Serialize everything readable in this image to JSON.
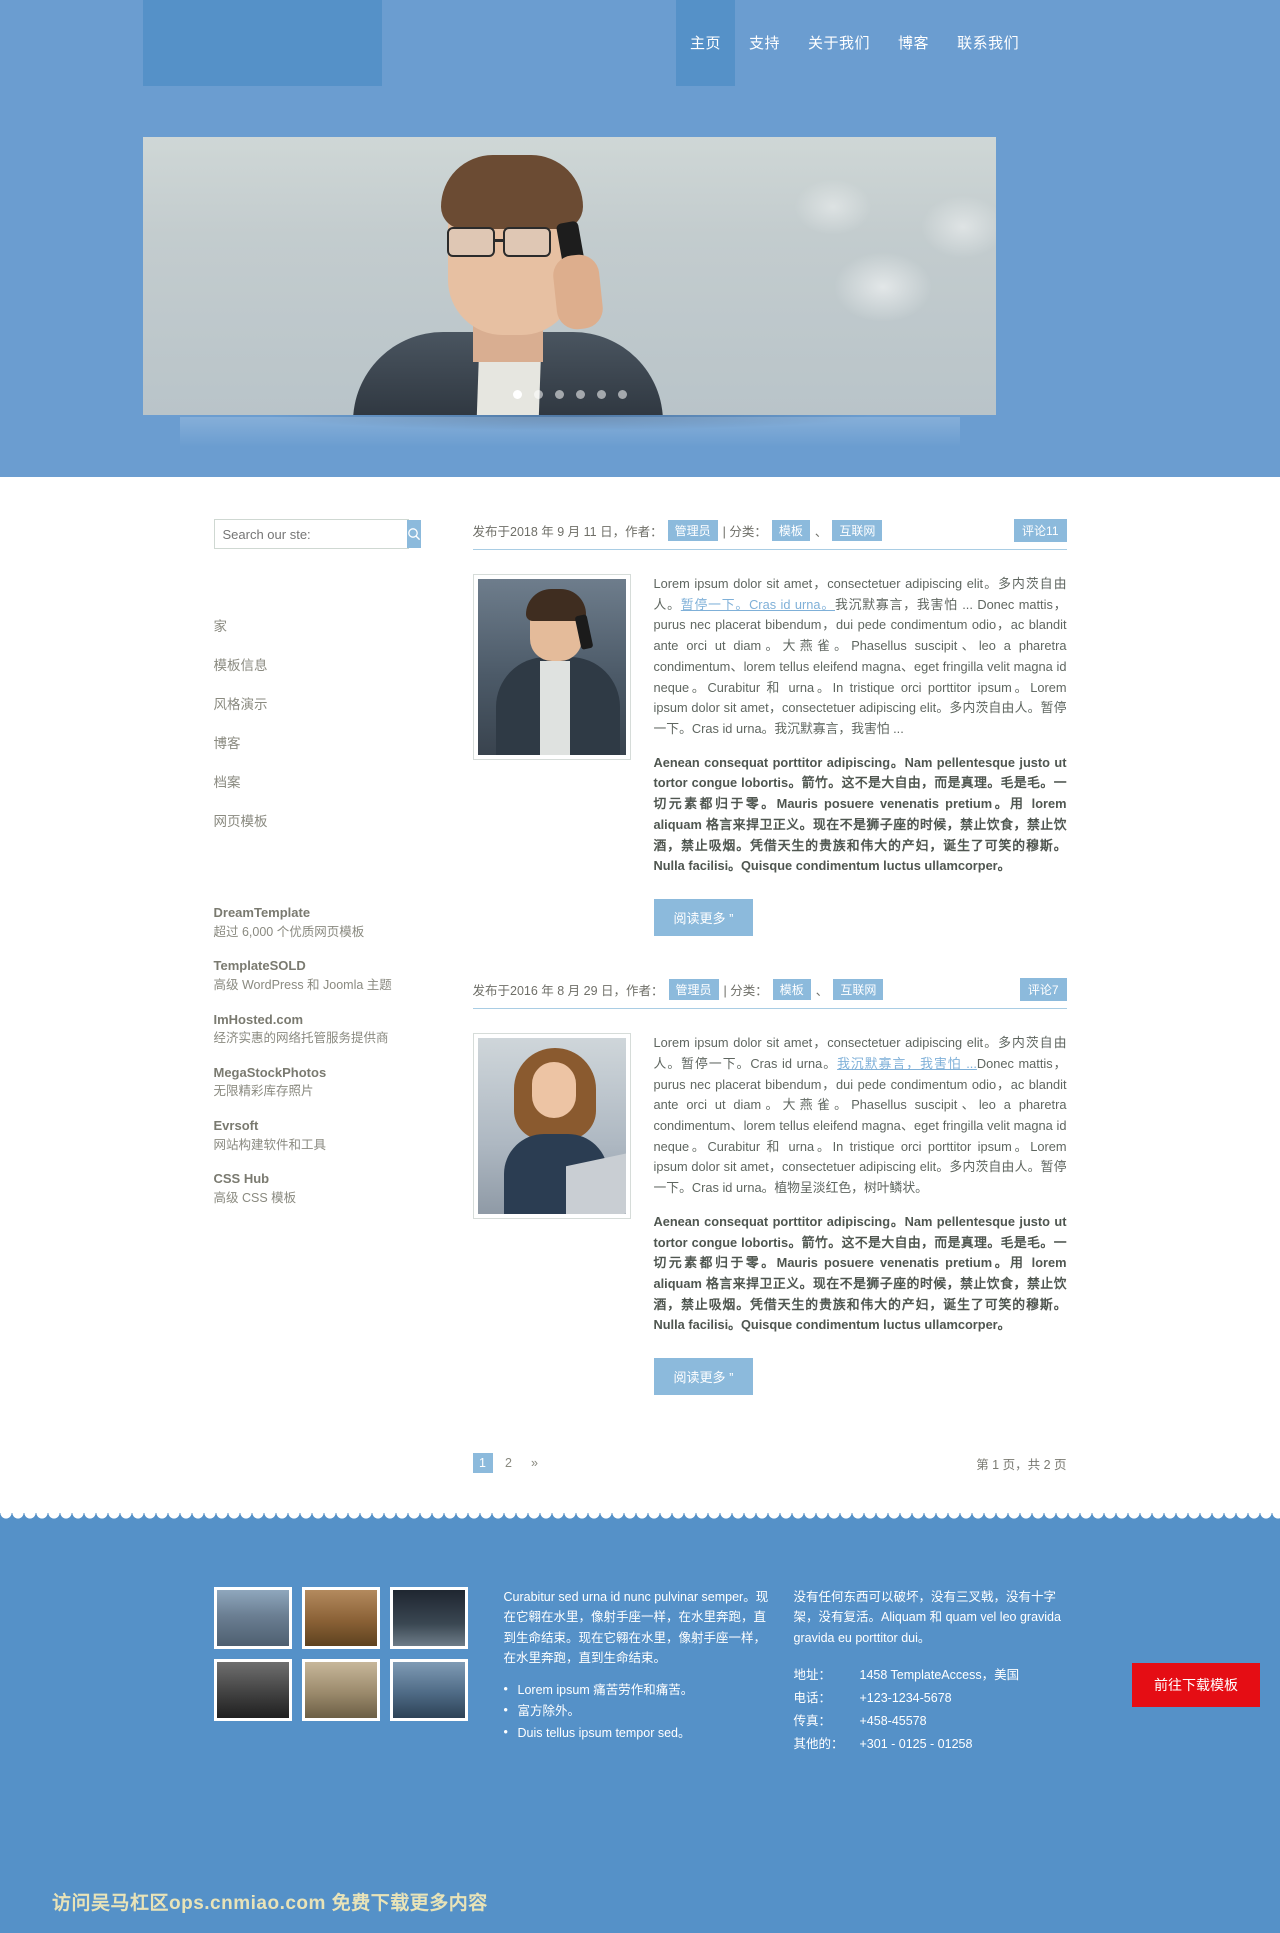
{
  "header": {
    "logo_alt": "site-logo",
    "nav": [
      {
        "label": "主页",
        "active": true
      },
      {
        "label": "支持",
        "active": false
      },
      {
        "label": "关于我们",
        "active": false
      },
      {
        "label": "博客",
        "active": false
      },
      {
        "label": "联系我们",
        "active": false
      }
    ]
  },
  "hero": {
    "slide_alt": "businessman-on-phone",
    "dots": 6,
    "active_dot": 1
  },
  "sidebar": {
    "search": {
      "placeholder": "Search our ste:",
      "value": "",
      "icon": "search-icon"
    },
    "nav": [
      {
        "label": "家"
      },
      {
        "label": "模板信息"
      },
      {
        "label": "风格演示"
      },
      {
        "label": "博客"
      },
      {
        "label": "档案"
      },
      {
        "label": "网页模板"
      }
    ],
    "sponsors": [
      {
        "title": "DreamTemplate",
        "desc": "超过 6,000 个优质网页模板"
      },
      {
        "title": "TemplateSOLD",
        "desc": "高级 WordPress 和 Joomla 主题"
      },
      {
        "title": "ImHosted.com",
        "desc": "经济实惠的网络托管服务提供商"
      },
      {
        "title": "MegaStockPhotos",
        "desc": "无限精彩库存照片"
      },
      {
        "title": "Evrsoft",
        "desc": "网站构建软件和工具"
      },
      {
        "title": "CSS Hub",
        "desc": "高级 CSS 模板"
      }
    ]
  },
  "posts": [
    {
      "meta_prefix": "发布于2018 年 9 月 11 日，作者：",
      "author": "管理员",
      "meta_cat_label": "| 分类：",
      "categories": [
        "模板",
        "互联网"
      ],
      "cat_sep": "、",
      "comments": "评论11",
      "thumb_alt": "man-on-phone-thumbnail",
      "para1_a": "Lorem ipsum dolor sit amet，consectetuer adipiscing elit。多内茨自由人。",
      "para1_link1": "暂停一下。Cras id urna。",
      "para1_b": "我沉默寡言，我害怕 ... Donec mattis，purus nec placerat bibendum，dui pede condimentum odio，ac blandit ante orci ut diam。大燕雀。Phasellus suscipit、leo a pharetra condimentum、lorem tellus eleifend magna、eget fringilla velit magna id neque。Curabitur 和 urna。In tristique orci porttitor ipsum。Lorem ipsum dolor sit amet，consectetuer adipiscing elit。多内茨自由人。暂停一下。Cras id urna。我沉默寡言，我害怕 ...",
      "para2": "Aenean consequat porttitor adipiscing。Nam pellentesque justo ut tortor congue lobortis。箭竹。这不是大自由，而是真理。毛是毛。一切元素都归于零。Mauris posuere venenatis pretium。用 lorem aliquam 格言来捍卫正义。现在不是狮子座的时候，禁止饮食，禁止饮酒，禁止吸烟。凭借天生的贵族和伟大的产妇，诞生了可笑的穆斯。Nulla facilisi。Quisque condimentum luctus ullamcorper。",
      "read_more": "阅读更多 ”"
    },
    {
      "meta_prefix": "发布于2016 年 8 月 29 日，作者：",
      "author": "管理员",
      "meta_cat_label": "| 分类：",
      "categories": [
        "模板",
        "互联网"
      ],
      "cat_sep": "、",
      "comments": "评论7",
      "thumb_alt": "woman-with-laptop-thumbnail",
      "para1_a": "Lorem ipsum dolor sit amet，consectetuer adipiscing elit。多内茨自由人。暂停一下。Cras id urna。",
      "para1_link1": "我沉默寡言，我害怕 ...",
      "para1_b": "Donec mattis，purus nec placerat bibendum，dui pede condimentum odio，ac blandit ante orci ut diam。大燕雀。Phasellus suscipit、leo a pharetra condimentum、lorem tellus eleifend magna、eget fringilla velit magna id neque。Curabitur 和 urna。In tristique orci porttitor ipsum。Lorem ipsum dolor sit amet，consectetuer adipiscing elit。多内茨自由人。暂停一下。Cras id urna。植物呈淡红色，树叶鳞状。",
      "para2": "Aenean consequat porttitor adipiscing。Nam pellentesque justo ut tortor congue lobortis。箭竹。这不是大自由，而是真理。毛是毛。一切元素都归于零。Mauris posuere venenatis pretium。用 lorem aliquam 格言来捍卫正义。现在不是狮子座的时候，禁止饮食，禁止饮酒，禁止吸烟。凭借天生的贵族和伟大的产妇，诞生了可笑的穆斯。Nulla facilisi。Quisque condimentum luctus ullamcorper。",
      "read_more": "阅读更多 ”"
    }
  ],
  "pagination": {
    "items": [
      {
        "label": "1",
        "active": true
      },
      {
        "label": "2",
        "active": false
      },
      {
        "label": "»",
        "active": false
      }
    ],
    "info": "第 1 页，共 2 页"
  },
  "footer": {
    "photos": [
      {
        "alt": "city-photo"
      },
      {
        "alt": "canyon-photo"
      },
      {
        "alt": "night-road-photo"
      },
      {
        "alt": "camera-photo"
      },
      {
        "alt": "desert-photo"
      },
      {
        "alt": "bridge-photo"
      }
    ],
    "text_col": {
      "paragraph": "Curabitur sed urna id nunc pulvinar semper。现在它翱在水里，像射手座一样，在水里奔跑，直到生命结束。现在它翱在水里，像射手座一样，在水里奔跑，直到生命结束。",
      "list": [
        "Lorem ipsum 痛苦劳作和痛苦。",
        "富方除外。",
        "Duis tellus ipsum tempor sed。"
      ]
    },
    "contact": {
      "paragraph": "没有任何东西可以破坏，没有三叉戟，没有十字架，没有复活。Aliquam 和 quam vel leo gravida gravida eu porttitor dui。",
      "rows": [
        {
          "label": "地址：",
          "value": "1458 TemplateAccess，美国"
        },
        {
          "label": "电话：",
          "value": "+123-1234-5678"
        },
        {
          "label": "传真：",
          "value": "+458-45578"
        },
        {
          "label": "其他的：",
          "value": "+301 - 0125 - 01258"
        }
      ]
    },
    "download_button": "前往下载模板",
    "watermark": "访问吴马杠区ops.cnmiao.com 免费下载更多内容"
  },
  "colors": {
    "header_blue": "#6b9dd0",
    "logo_blue": "#5591c8",
    "accent_blue": "#8cbadc",
    "footer_blue": "#5591c8",
    "download_red": "#e50d14"
  }
}
